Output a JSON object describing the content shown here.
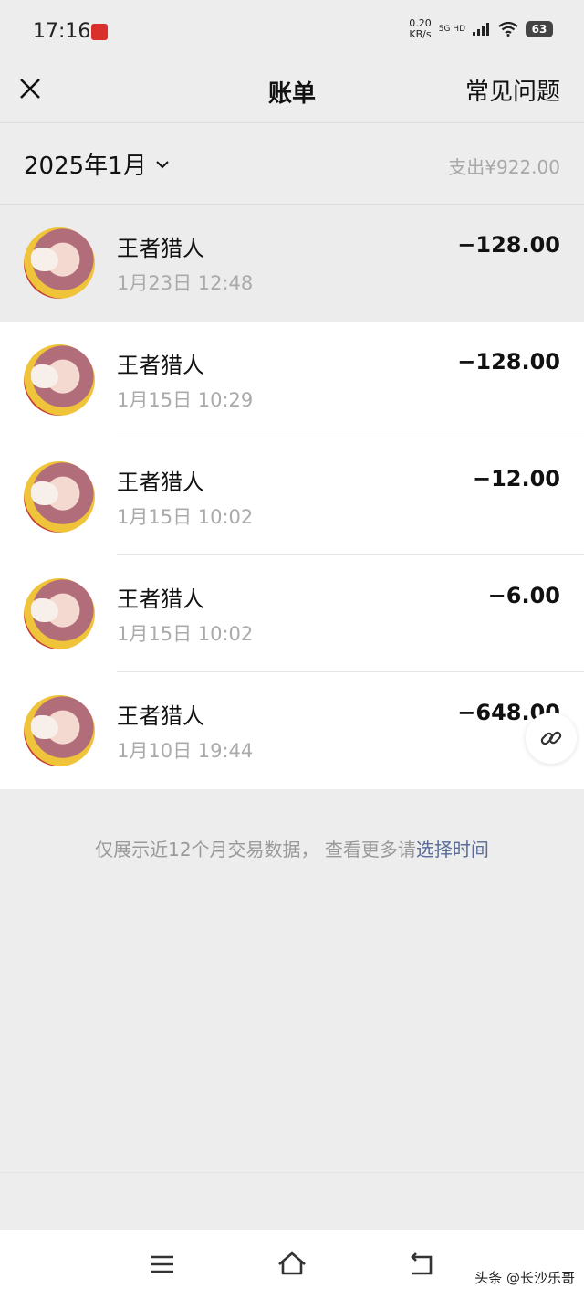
{
  "status_bar": {
    "time": "17:16",
    "net_speed_value": "0.20",
    "net_speed_unit": "KB/s",
    "network": "5G HD",
    "battery": "63"
  },
  "nav": {
    "title": "账单",
    "faq_label": "常见问题"
  },
  "month_bar": {
    "month_label": "2025年1月",
    "expense_summary": "支出¥922.00"
  },
  "transactions": [
    {
      "merchant": "王者猎人",
      "time": "1月23日 12:48",
      "amount": "−128.00",
      "highlighted": true
    },
    {
      "merchant": "王者猎人",
      "time": "1月15日 10:29",
      "amount": "−128.00"
    },
    {
      "merchant": "王者猎人",
      "time": "1月15日 10:02",
      "amount": "−12.00"
    },
    {
      "merchant": "王者猎人",
      "time": "1月15日 10:02",
      "amount": "−6.00"
    },
    {
      "merchant": "王者猎人",
      "time": "1月10日 19:44",
      "amount": "−648.00"
    }
  ],
  "footer": {
    "note": "仅展示近12个月交易数据， 查看更多请",
    "link": "选择时间"
  },
  "icons": {
    "close": "close-icon",
    "chevron": "chevron-down-icon",
    "link": "link-icon",
    "menu": "menu-icon",
    "home": "home-icon",
    "back": "back-icon"
  },
  "watermark": "头条 @长沙乐哥",
  "colors": {
    "background": "#ededed",
    "link": "#576b95",
    "muted": "#aaaaaa"
  }
}
